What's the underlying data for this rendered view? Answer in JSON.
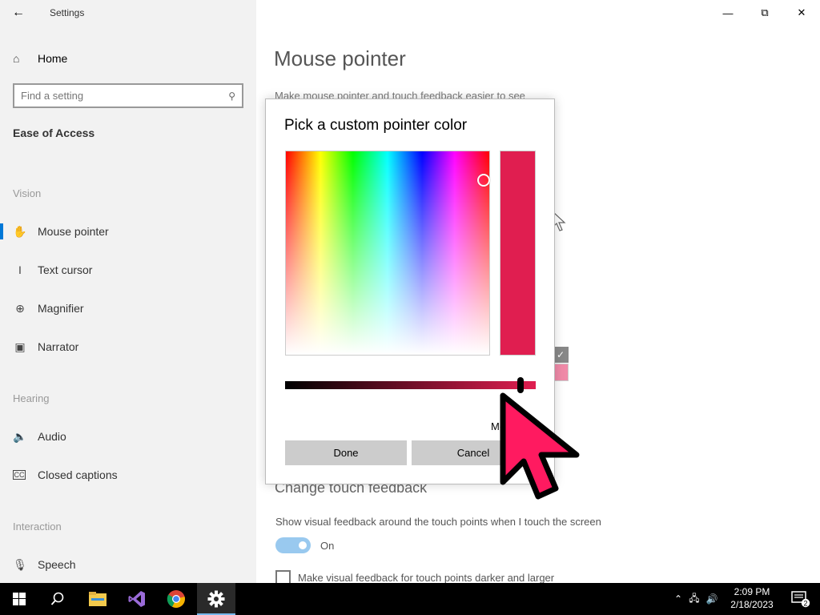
{
  "window": {
    "title": "Settings"
  },
  "sidebar": {
    "home_label": "Home",
    "search_placeholder": "Find a setting",
    "section_title": "Ease of Access",
    "groups": {
      "vision": "Vision",
      "hearing": "Hearing",
      "interaction": "Interaction"
    },
    "items": [
      {
        "label": "Mouse pointer",
        "icon": "mouse-pointer-icon",
        "selected": true
      },
      {
        "label": "Text cursor",
        "icon": "text-cursor-icon"
      },
      {
        "label": "Magnifier",
        "icon": "magnifier-icon"
      },
      {
        "label": "Narrator",
        "icon": "narrator-icon"
      },
      {
        "label": "Audio",
        "icon": "audio-icon"
      },
      {
        "label": "Closed captions",
        "icon": "closed-captions-icon"
      },
      {
        "label": "Speech",
        "icon": "microphone-icon"
      }
    ]
  },
  "main": {
    "title": "Mouse pointer",
    "description": "Make mouse pointer and touch feedback easier to see",
    "touch_heading": "Change touch feedback",
    "touch_description": "Show visual feedback around the touch points when I touch the screen",
    "toggle_label": "On",
    "toggle_on": true,
    "checkbox_label": "Make visual feedback for touch points darker and larger",
    "checkbox_checked": false
  },
  "dialog": {
    "title": "Pick a custom pointer color",
    "selected_color": "#e01e50",
    "more_label": "Mo",
    "done_label": "Done",
    "cancel_label": "Cancel",
    "value_slider_level": 0.94
  },
  "colors": {
    "accent": "#0078d7",
    "pointer": "#ff1a60"
  },
  "taskbar": {
    "apps": [
      "start-icon",
      "search-icon",
      "file-explorer-icon",
      "visual-studio-icon",
      "chrome-icon",
      "settings-icon"
    ],
    "time": "2:09 PM",
    "date": "2/18/2023",
    "notification_count": "2"
  }
}
